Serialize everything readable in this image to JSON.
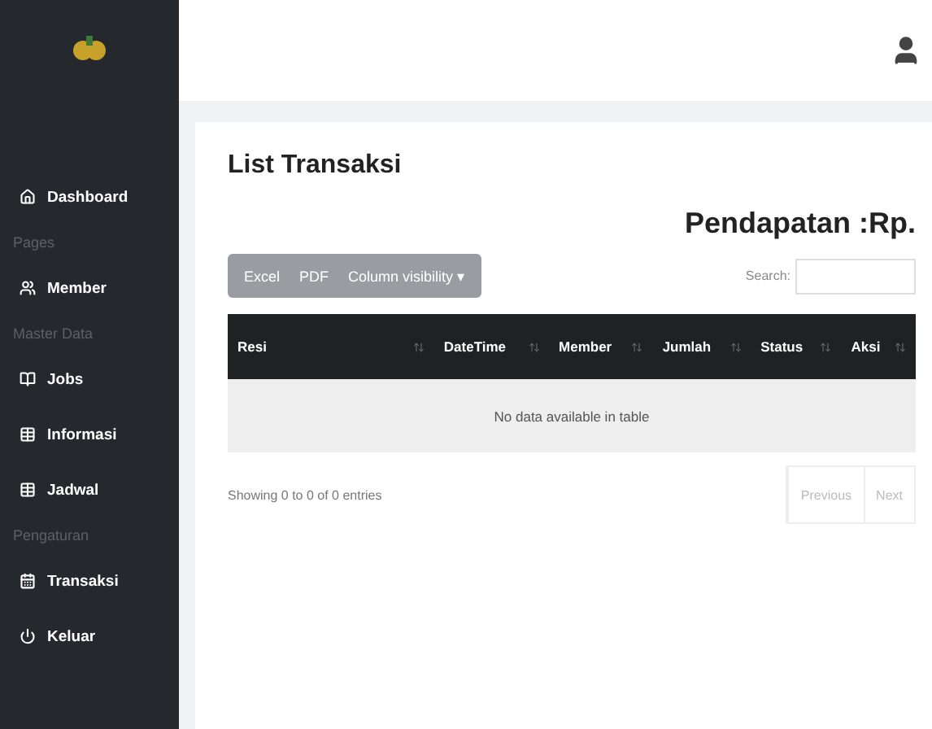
{
  "sidebar": {
    "items": [
      {
        "kind": "link",
        "label": "Dashboard"
      },
      {
        "kind": "heading",
        "label": "Pages"
      },
      {
        "kind": "link",
        "label": "Member"
      },
      {
        "kind": "heading",
        "label": "Master Data"
      },
      {
        "kind": "link",
        "label": "Jobs"
      },
      {
        "kind": "link",
        "label": "Informasi"
      },
      {
        "kind": "link",
        "label": "Jadwal"
      },
      {
        "kind": "heading",
        "label": "Pengaturan"
      },
      {
        "kind": "link",
        "label": "Transaksi"
      },
      {
        "kind": "link",
        "label": "Keluar"
      }
    ]
  },
  "card": {
    "title": "List Transaksi",
    "income": "Pendapatan :Rp.",
    "export_buttons": [
      "Excel",
      "PDF",
      "Column visibility ▾"
    ],
    "search": {
      "label": "Search:"
    },
    "table": {
      "columns": [
        "Resi",
        "DateTime",
        "Member",
        "Jumlah",
        "Status",
        "Aksi"
      ],
      "empty": "No data available in table"
    },
    "info": "Showing 0 to 0 of 0 entries",
    "pagination": [
      {
        "label": "Previous",
        "disabled": true
      },
      {
        "label": "Next",
        "disabled": true
      }
    ]
  }
}
